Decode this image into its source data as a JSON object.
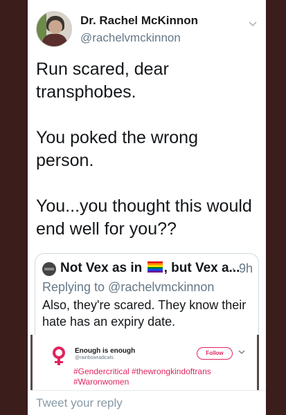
{
  "tweet": {
    "display_name": "Dr. Rachel McKinnon",
    "handle": "@rachelvmckinnon",
    "text": "Run scared, dear transphobes.\n\nYou poked the wrong person.\n\nYou...you thought this would end well for you??"
  },
  "quoted_tweet": {
    "name_prefix": "Not Vex as in",
    "name_suffix": ", but Vex a...",
    "time": "· 9h",
    "replying_to": "Replying to @rachelvmckinnon",
    "text": "Also, they're scared.  They know their hate has an expiry date."
  },
  "embedded_tweet": {
    "name": "Enough is enough",
    "handle": "@rainbowradicals",
    "follow_label": "Follow",
    "hashtags": "#Gendercritical #thewrongkindoftrans #Waronwomen"
  },
  "reply_bar": {
    "placeholder": "Tweet your reply"
  },
  "colors": {
    "link": "#657786",
    "accent": "#e0245e",
    "text": "#14171a"
  }
}
